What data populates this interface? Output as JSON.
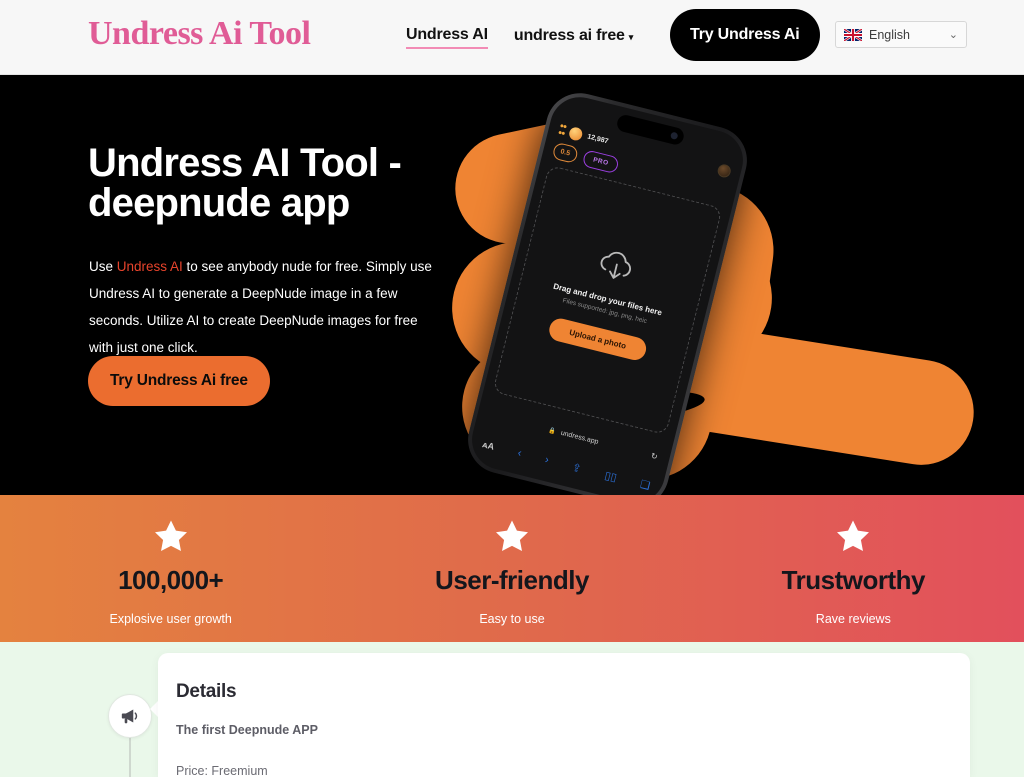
{
  "header": {
    "logo": "Undress Ai Tool",
    "nav": [
      {
        "label": "Undress AI",
        "active": true,
        "has_caret": false
      },
      {
        "label": "undress ai free",
        "active": false,
        "has_caret": true
      }
    ],
    "cta_label": "Try Undress Ai",
    "language": {
      "label": "English",
      "flag_icon": "uk-flag-icon",
      "caret_icon": "chevron-down-icon"
    }
  },
  "hero": {
    "title": "Undress AI Tool - deepnude app",
    "body_pre": "Use ",
    "body_highlight": "Undress AI",
    "body_post": " to see anybody nude for free. Simply use Undress AI to generate a DeepNude image in a few seconds. Utilize AI to create DeepNude images for free with just one click.",
    "button_label": "Try Undress Ai free",
    "background_color": "#000000",
    "accent_color": "#e8442c",
    "blob_color": "#ef8433"
  },
  "phone": {
    "status_coin_count": "12,987",
    "badge_coin": "0.5",
    "badge_pro": "PRO",
    "dropzone_title": "Drag and drop your files here",
    "dropzone_subtitle": "Files supported: jpg, png, heic",
    "dropzone_button": "Upload a photo",
    "cloud_icon": "cloud-upload-icon",
    "safari_url": "undress.app",
    "safari_lock_icon": "lock-icon",
    "safari_reload_icon": "reload-icon"
  },
  "stats": [
    {
      "star_icon": "star-icon",
      "value": "100,000+",
      "label": "Explosive user growth"
    },
    {
      "star_icon": "star-icon",
      "value": "User-friendly",
      "label": "Easy to use"
    },
    {
      "star_icon": "star-icon",
      "value": "Trustworthy",
      "label": "Rave reviews"
    }
  ],
  "details": {
    "timeline_icon": "megaphone-icon",
    "title": "Details",
    "subtitle": "The first Deepnude APP",
    "price": "Price: Freemium",
    "background_color": "#eaf8ea"
  }
}
